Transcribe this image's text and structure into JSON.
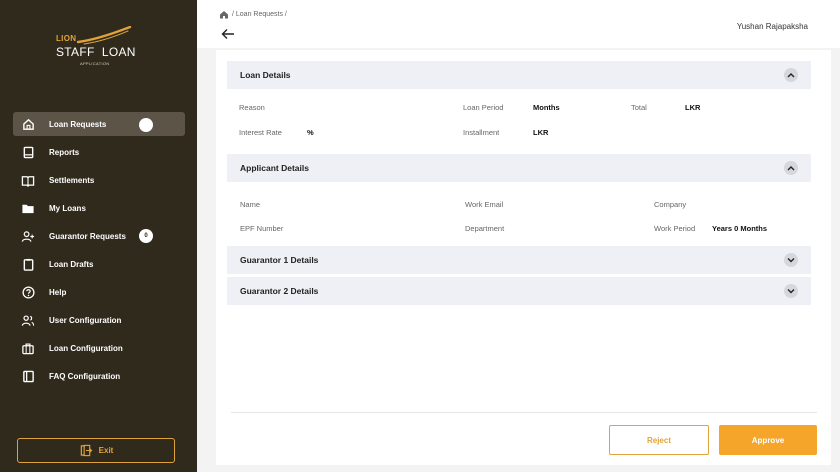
{
  "logo": {
    "brand": "LION",
    "title": "STAFF  LOAN",
    "subtitle": "APPLICATION"
  },
  "sidebar": {
    "items": [
      {
        "label": "Loan Requests",
        "icon": "home-icon",
        "active": true
      },
      {
        "label": "Reports",
        "icon": "report-icon"
      },
      {
        "label": "Settlements",
        "icon": "book-icon"
      },
      {
        "label": "My Loans",
        "icon": "folder-icon"
      },
      {
        "label": "Guarantor Requests",
        "icon": "add-user-icon",
        "badge": "0"
      },
      {
        "label": "Loan Drafts",
        "icon": "clipboard-icon"
      },
      {
        "label": "Help",
        "icon": "help-icon"
      },
      {
        "label": "User Configuration",
        "icon": "users-icon"
      },
      {
        "label": "Loan Configuration",
        "icon": "briefcase-icon"
      },
      {
        "label": "FAQ Configuration",
        "icon": "faq-book-icon"
      }
    ],
    "exit_label": "Exit"
  },
  "header": {
    "breadcrumb": "/ Loan Requests /",
    "user": "Yushan Rajapaksha"
  },
  "loan_details": {
    "title": "Loan Details",
    "reason_label": "Reason",
    "period_label": "Loan Period",
    "period_value": "Months",
    "total_label": "Total",
    "total_value": "LKR",
    "rate_label": "Interest Rate",
    "rate_value": "%",
    "installment_label": "Installment",
    "installment_value": "LKR"
  },
  "applicant_details": {
    "title": "Applicant Details",
    "name_label": "Name",
    "email_label": "Work Email",
    "company_label": "Company",
    "epf_label": "EPF Number",
    "department_label": "Department",
    "work_period_label": "Work Period",
    "work_period_value": "Years 0 Months"
  },
  "guarantor1": {
    "title": "Guarantor 1 Details"
  },
  "guarantor2": {
    "title": "Guarantor 2 Details"
  },
  "actions": {
    "reject": "Reject",
    "approve": "Approve"
  },
  "colors": {
    "sidebar": "#302a1c",
    "accent": "#f5a52a",
    "section_bg": "#eff0f5"
  }
}
